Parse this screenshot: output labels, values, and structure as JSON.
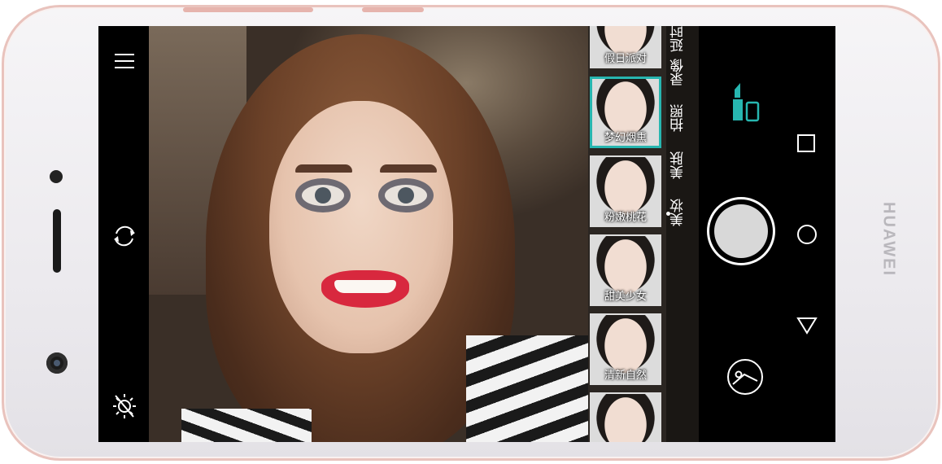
{
  "device": {
    "brand": "HUAWEI"
  },
  "camera": {
    "left_bar": {
      "menu_icon": "hamburger-menu-icon",
      "switch_icon": "switch-camera-icon",
      "flash_icon": "flash-off-icon"
    },
    "makeup_filters": [
      {
        "label": "假日派对",
        "selected": false
      },
      {
        "label": "梦幻烟熏",
        "selected": true
      },
      {
        "label": "粉嫩桃花",
        "selected": false
      },
      {
        "label": "甜美少女",
        "selected": false
      },
      {
        "label": "清新自然",
        "selected": false
      },
      {
        "label": "",
        "selected": false
      }
    ],
    "modes": [
      {
        "label": "延时",
        "active": false
      },
      {
        "label": "录像",
        "active": false
      },
      {
        "label": "拍照",
        "active": false
      },
      {
        "label": "美肤",
        "active": false
      },
      {
        "label": "美妆",
        "active": true
      }
    ],
    "right_bar": {
      "makeup_icon": "lipstick-icon",
      "shutter_icon": "shutter-button",
      "gallery_icon": "gallery-thumbnail-icon",
      "accent_color": "#27b6b0"
    },
    "nav": {
      "recents_icon": "recents-square-icon",
      "home_icon": "home-circle-icon",
      "back_icon": "back-triangle-icon"
    }
  }
}
